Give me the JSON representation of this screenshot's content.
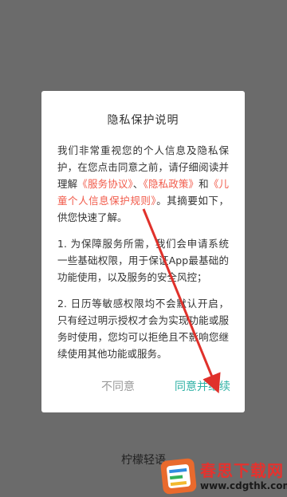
{
  "dialog": {
    "title": "隐私保护说明",
    "intro_1": "我们非常重视您的个人信息及隐私保护，在您点击同意之前，请仔细阅读并理解",
    "link_service": "《服务协议》",
    "sep": "、",
    "link_privacy": "《隐私政策》",
    "and": "和",
    "link_children": "《儿童个人信息保护规则》",
    "intro_2": "。其摘要如下，供您快速了解。",
    "point_1": "1. 为保障服务所需，我们会申请系统一些基础权限，用于保证App最基础的功能使用，以及服务的安全风控；",
    "point_2": "2. 日历等敏感权限均不会默认开启，只有经过明示授权才会为实现功能或服务时使用，您均可以拒绝且不影响您继续使用其他功能或服务。",
    "disagree_label": "不同意",
    "agree_label": "同意并继续"
  },
  "background": {
    "app_name": "柠檬轻语"
  },
  "watermark": {
    "name": "春思下载网",
    "url": "www.cdgthk.com"
  },
  "colors": {
    "link": "#f15a4a",
    "accent": "#31b2a6",
    "arrow": "#e0312b"
  }
}
